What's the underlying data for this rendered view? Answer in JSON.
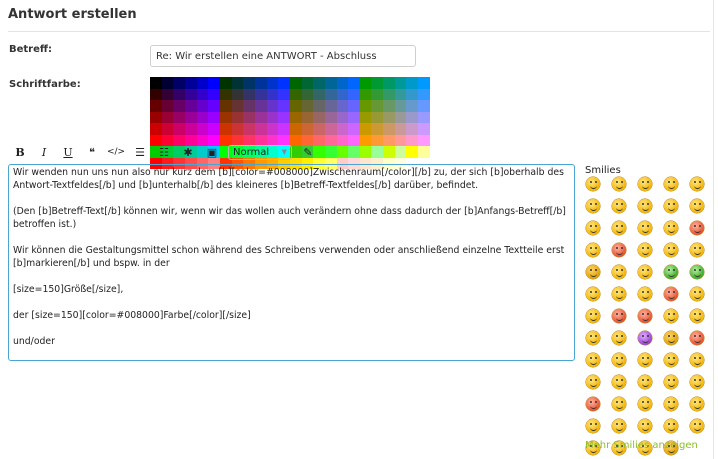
{
  "header": {
    "title": "Antwort erstellen"
  },
  "form": {
    "subject_label": "Betreff:",
    "subject_value": "Re: Wir erstellen eine ANTWORT - Abschluss",
    "color_label": "Schriftfarbe:"
  },
  "palette": {
    "rows": [
      [
        "#000000",
        "#000033",
        "#000066",
        "#000099",
        "#0000cc",
        "#0000ff",
        "#003300",
        "#003333",
        "#003366",
        "#003399",
        "#0033cc",
        "#0033ff",
        "#006600",
        "#006633",
        "#006666",
        "#006699",
        "#0066cc",
        "#0066ff",
        "#009900",
        "#009933",
        "#009966",
        "#009999",
        "#0099cc",
        "#0099ff"
      ],
      [
        "#330000",
        "#330033",
        "#330066",
        "#330099",
        "#3300cc",
        "#3300ff",
        "#333300",
        "#333333",
        "#333366",
        "#333399",
        "#3333cc",
        "#3333ff",
        "#336600",
        "#336633",
        "#336666",
        "#336699",
        "#3366cc",
        "#3366ff",
        "#339900",
        "#339933",
        "#339966",
        "#339999",
        "#3399cc",
        "#3399ff"
      ],
      [
        "#660000",
        "#660033",
        "#660066",
        "#660099",
        "#6600cc",
        "#6600ff",
        "#663300",
        "#663333",
        "#663366",
        "#663399",
        "#6633cc",
        "#6633ff",
        "#666600",
        "#666633",
        "#666666",
        "#666699",
        "#6666cc",
        "#6666ff",
        "#669900",
        "#669933",
        "#669966",
        "#669999",
        "#6699cc",
        "#6699ff"
      ],
      [
        "#990000",
        "#990033",
        "#990066",
        "#990099",
        "#9900cc",
        "#9900ff",
        "#993300",
        "#993333",
        "#993366",
        "#993399",
        "#9933cc",
        "#9933ff",
        "#996600",
        "#996633",
        "#996666",
        "#996699",
        "#9966cc",
        "#9966ff",
        "#999900",
        "#999933",
        "#999966",
        "#999999",
        "#9999cc",
        "#9999ff"
      ],
      [
        "#cc0000",
        "#cc0033",
        "#cc0066",
        "#cc0099",
        "#cc00cc",
        "#cc00ff",
        "#cc3300",
        "#cc3333",
        "#cc3366",
        "#cc3399",
        "#cc33cc",
        "#cc33ff",
        "#cc6600",
        "#cc6633",
        "#cc6666",
        "#cc6699",
        "#cc66cc",
        "#cc66ff",
        "#cc9900",
        "#cc9933",
        "#cc9966",
        "#cc9999",
        "#cc99cc",
        "#cc99ff"
      ],
      [
        "#ff0000",
        "#ff0033",
        "#ff0066",
        "#ff0099",
        "#ff00cc",
        "#ff00ff",
        "#ff3300",
        "#ff3333",
        "#ff3366",
        "#ff3399",
        "#ff33cc",
        "#ff33ff",
        "#ff6600",
        "#ff6633",
        "#ff6666",
        "#ff6699",
        "#ff66cc",
        "#ff66ff",
        "#ff9900",
        "#ff9933",
        "#ff9966",
        "#ff9999",
        "#ff99cc",
        "#ff99ff"
      ],
      [
        "#00cc00",
        "#00cc33",
        "#00cc66",
        "#00cc99",
        "#00cccc",
        "#00ccff",
        "#00ff00",
        "#00ff33",
        "#00ff66",
        "#00ff99",
        "#00ffcc",
        "#00ffff",
        "#33cc00",
        "#33cc33",
        "#33ff00",
        "#33ff33",
        "#66ff00",
        "#66ff66",
        "#99ff00",
        "#99ff99",
        "#ccff00",
        "#ccff99",
        "#ffff00",
        "#ffff99"
      ],
      [
        "#ff0000",
        "#ff1a1a",
        "#ff3333",
        "#ff4d4d",
        "#ff6666",
        "#ff8080",
        "#ff3300",
        "#ff5500",
        "#ff7700",
        "#ff9900",
        "#ffaa00",
        "#ffcc00",
        "#ffdd00",
        "#ffee00",
        "#ffff33",
        "#ffff66",
        "#ffcccc",
        "#ffd9d9",
        "#ffe6cc",
        "#fff0cc",
        "#ffffcc",
        "#ffffe0",
        "#ffffff",
        "#ffffff"
      ]
    ]
  },
  "toolbar": {
    "bold": "B",
    "italic": "I",
    "underline": "U",
    "quote": "❝",
    "code": "</>",
    "list_unordered": "☰",
    "list_ordered": "☷",
    "star": "✱",
    "image": "▣",
    "font_size": "Normal",
    "color_picker": "✎"
  },
  "editor": {
    "paragraphs": [
      "Wir wenden nun uns nun also nur kurz dem [b][color=#008000]Zwischenraum[/color][/b] zu, der sich [b]oberhalb des Antwort-Textfeldes[/b] und [b]unterhalb[/b] des kleineres [b]Betreff-Textfeldes[/b] darüber, befindet.",
      "(Den [b]Betreff-Text[/b] können wir, wenn wir das wollen auch verändern ohne dass dadurch der [b]Anfangs-Betreff[/b] betroffen ist.)",
      "Wir können die Gestaltungsmittel schon während des Schreibens verwenden oder anschließend einzelne Textteile erst [b]markieren[/b] und bspw. in der",
      "[size=150]Größe[/size],",
      "der [size=150][color=#008000]Farbe[/color][/size]",
      "und/oder"
    ]
  },
  "smilies": {
    "title": "Smilies",
    "more_link": "Mehr Smilies anzeigen",
    "items": [
      {
        "name": "grin-smiley",
        "tone": ""
      },
      {
        "name": "laugh-smiley",
        "tone": ""
      },
      {
        "name": "smile-smiley",
        "tone": ""
      },
      {
        "name": "happy-smiley",
        "tone": ""
      },
      {
        "name": "wink-smiley",
        "tone": ""
      },
      {
        "name": "glad-smiley",
        "tone": ""
      },
      {
        "name": "tongue-smiley",
        "tone": ""
      },
      {
        "name": "cool-smiley",
        "tone": ""
      },
      {
        "name": "shock-smiley",
        "tone": ""
      },
      {
        "name": "nerd-smiley",
        "tone": ""
      },
      {
        "name": "thinking-smiley",
        "tone": ""
      },
      {
        "name": "grumpy-smiley",
        "tone": ""
      },
      {
        "name": "confused-smiley",
        "tone": ""
      },
      {
        "name": "blush-smiley",
        "tone": ""
      },
      {
        "name": "angry-smiley",
        "tone": "red"
      },
      {
        "name": "cat-smiley",
        "tone": ""
      },
      {
        "name": "devil-cat-smiley",
        "tone": "red"
      },
      {
        "name": "surprised-smiley",
        "tone": ""
      },
      {
        "name": "exclaim-smiley",
        "tone": ""
      },
      {
        "name": "question-smiley",
        "tone": ""
      },
      {
        "name": "arrow-smiley",
        "tone": "dark"
      },
      {
        "name": "neutral-smiley",
        "tone": ""
      },
      {
        "name": "eek-smiley",
        "tone": ""
      },
      {
        "name": "alien-smiley",
        "tone": "green"
      },
      {
        "name": "frog-smiley",
        "tone": "green"
      },
      {
        "name": "roll-eyes-smiley",
        "tone": ""
      },
      {
        "name": "glasses-smiley",
        "tone": ""
      },
      {
        "name": "sweat-smiley",
        "tone": ""
      },
      {
        "name": "kiss-smiley",
        "tone": "red"
      },
      {
        "name": "sick-smiley",
        "tone": ""
      },
      {
        "name": "cry-smiley",
        "tone": ""
      },
      {
        "name": "lol-smiley",
        "tone": "red"
      },
      {
        "name": "heart-smiley",
        "tone": "red"
      },
      {
        "name": "yawn-smiley",
        "tone": ""
      },
      {
        "name": "shades-smiley",
        "tone": ""
      },
      {
        "name": "sleepy-smiley",
        "tone": ""
      },
      {
        "name": "silly-smiley",
        "tone": ""
      },
      {
        "name": "evil-smiley",
        "tone": "purple"
      },
      {
        "name": "eyes-smiley",
        "tone": "dark"
      },
      {
        "name": "mad-smiley",
        "tone": "red"
      },
      {
        "name": "sad-smiley",
        "tone": ""
      },
      {
        "name": "guitar-smiley",
        "tone": ""
      },
      {
        "name": "party-smiley",
        "tone": ""
      },
      {
        "name": "dance-smiley",
        "tone": ""
      },
      {
        "name": "bike-smiley",
        "tone": ""
      },
      {
        "name": "hat-smiley",
        "tone": ""
      },
      {
        "name": "book-smiley",
        "tone": ""
      },
      {
        "name": "sword-smiley",
        "tone": ""
      },
      {
        "name": "clown-smiley",
        "tone": ""
      },
      {
        "name": "hug-smiley",
        "tone": ""
      },
      {
        "name": "jester-smiley",
        "tone": "red"
      },
      {
        "name": "wave-smiley",
        "tone": ""
      },
      {
        "name": "think-smiley",
        "tone": ""
      },
      {
        "name": "peek-smiley",
        "tone": ""
      },
      {
        "name": "shy-smiley",
        "tone": ""
      },
      {
        "name": "music-smiley",
        "tone": ""
      },
      {
        "name": "ninja-smiley",
        "tone": ""
      },
      {
        "name": "drink-smiley",
        "tone": ""
      },
      {
        "name": "yes-smiley",
        "tone": ""
      },
      {
        "name": "no-smiley",
        "tone": ""
      },
      {
        "name": "sleep-smiley",
        "tone": ""
      },
      {
        "name": "bored-smiley",
        "tone": ""
      },
      {
        "name": "hmm-smiley",
        "tone": ""
      },
      {
        "name": "bee-smiley",
        "tone": "dark"
      }
    ]
  }
}
